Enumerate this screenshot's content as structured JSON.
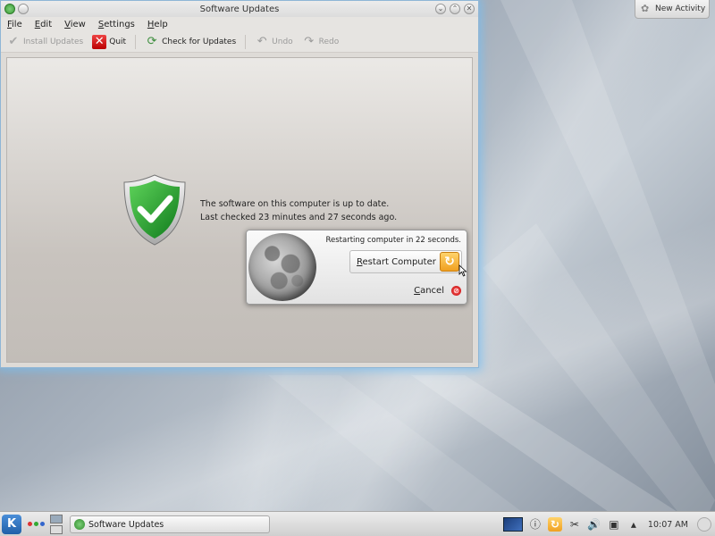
{
  "desktop": {
    "new_activity_label": "New Activity"
  },
  "window": {
    "title": "Software Updates",
    "menu": [
      "File",
      "Edit",
      "View",
      "Settings",
      "Help"
    ],
    "toolbar": {
      "install_updates": "Install Updates",
      "quit": "Quit",
      "check_for_updates": "Check for Updates",
      "undo": "Undo",
      "redo": "Redo"
    },
    "status": {
      "line1": "The software on this computer is up to date.",
      "line2": "Last checked 23 minutes and 27 seconds ago."
    }
  },
  "restart_dialog": {
    "message": "Restarting computer in 22 seconds.",
    "restart_label": "Restart Computer",
    "cancel_label": "Cancel"
  },
  "taskbar": {
    "task_label": "Software Updates",
    "clock": "10:07 AM"
  },
  "colors": {
    "shield_green": "#1e9a2c",
    "window_glow": "#78bef0",
    "update_orange": "#f0a020"
  },
  "icons": {
    "install": "checkmark-icon",
    "quit": "quit-icon",
    "check": "refresh-gear-icon",
    "undo": "undo-icon",
    "redo": "redo-icon",
    "shield": "shield-check-icon",
    "moon": "moon-icon",
    "restart": "restart-icon",
    "cancel": "cancel-icon"
  }
}
